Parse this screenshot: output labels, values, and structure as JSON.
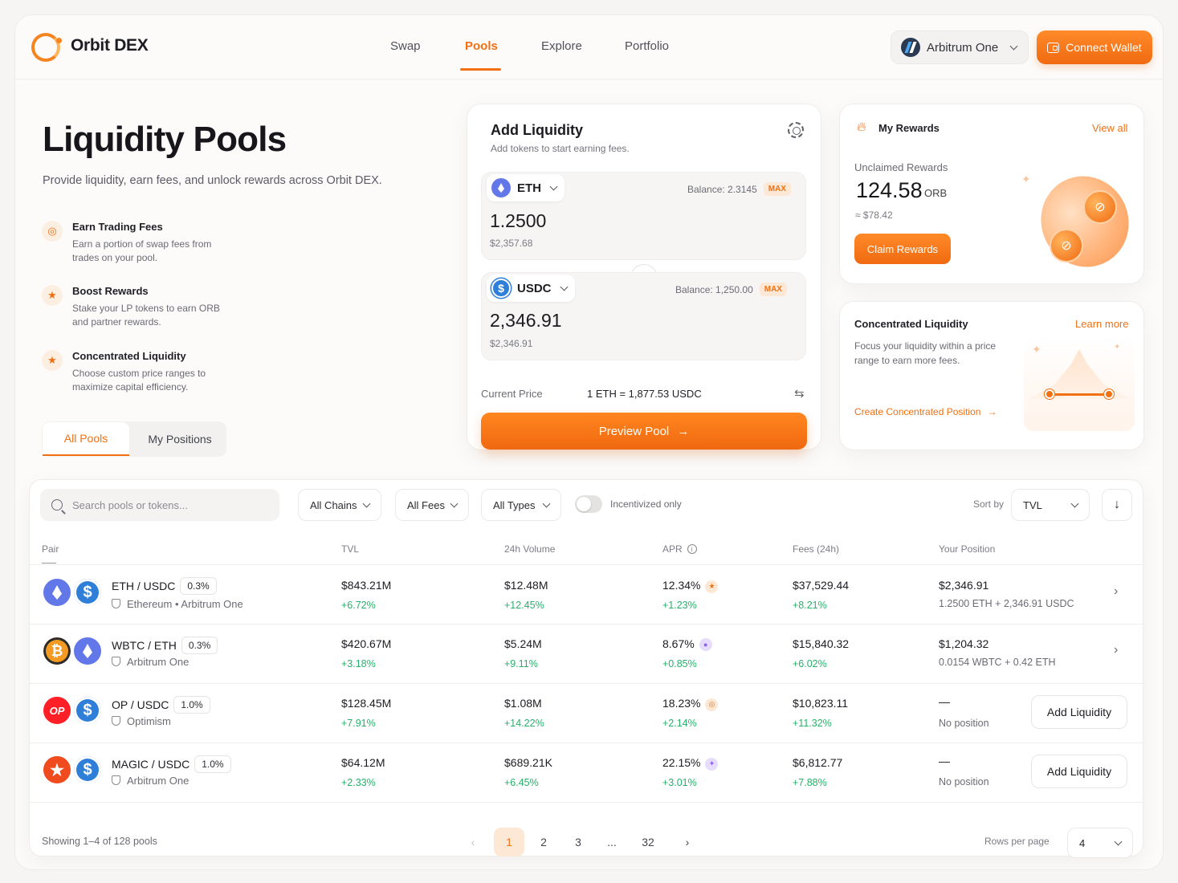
{
  "brand": {
    "name": "Orbit DEX"
  },
  "nav": {
    "items": [
      "Swap",
      "Pools",
      "Explore",
      "Portfolio"
    ],
    "active": "Pools"
  },
  "header": {
    "chain": "Arbitrum One",
    "connect_label": "Connect Wallet"
  },
  "hero": {
    "title": "Liquidity Pools",
    "subtitle": "Provide liquidity, earn fees, and unlock rewards across Orbit DEX.",
    "features": [
      {
        "title": "Earn Trading Fees",
        "desc": "Earn a portion of swap fees from trades on your pool."
      },
      {
        "title": "Boost Rewards",
        "desc": "Stake your LP tokens to earn ORB and partner rewards."
      },
      {
        "title": "Concentrated Liquidity",
        "desc": "Choose custom price ranges to maximize capital efficiency."
      }
    ]
  },
  "tabs": {
    "all": "All Pools",
    "mine": "My Positions"
  },
  "add_liquidity": {
    "title": "Add Liquidity",
    "subtitle": "Add tokens to start earning fees.",
    "token_a": {
      "symbol": "ETH",
      "balance": "Balance: 2.3145",
      "max": "MAX",
      "amount": "1.2500",
      "usd": "$2,357.68"
    },
    "token_b": {
      "symbol": "USDC",
      "balance": "Balance: 1,250.00",
      "max": "MAX",
      "amount": "2,346.91",
      "usd": "$2,346.91"
    },
    "price_label": "Current Price",
    "price_value": "1 ETH = 1,877.53 USDC",
    "preview_label": "Preview Pool"
  },
  "rewards": {
    "title": "My Rewards",
    "view_all": "View all",
    "label": "Unclaimed Rewards",
    "amount": "124.58",
    "unit": "ORB",
    "usd": "≈ $78.42",
    "claim_label": "Claim Rewards"
  },
  "concentrated": {
    "title": "Concentrated Liquidity",
    "learn_more": "Learn more",
    "desc": "Focus your liquidity within a price range to earn more fees.",
    "link": "Create Concentrated Position"
  },
  "filters": {
    "search_placeholder": "Search pools or tokens...",
    "chains": "All Chains",
    "fees": "All Fees",
    "types": "All Types",
    "incentivized": "Incentivized only",
    "sort_label": "Sort by",
    "sort_value": "TVL"
  },
  "table": {
    "columns": [
      "Pair",
      "TVL",
      "24h Volume",
      "APR",
      "Fees (24h)",
      "Your Position"
    ],
    "rows": [
      {
        "pair": "ETH / USDC",
        "fee": "0.3%",
        "chain": "Ethereum • Arbitrum One",
        "tvl": "$843.21M",
        "tvl_d": "+6.72%",
        "vol": "$12.48M",
        "vol_d": "+12.45%",
        "apr": "12.34%",
        "apr_d": "+1.23%",
        "fees": "$37,529.44",
        "fees_d": "+8.21%",
        "pos": "$2,346.91",
        "pos_sub": "1.2500 ETH + 2,346.91 USDC",
        "action": ""
      },
      {
        "pair": "WBTC / ETH",
        "fee": "0.3%",
        "chain": "Arbitrum One",
        "tvl": "$420.67M",
        "tvl_d": "+3.18%",
        "vol": "$5.24M",
        "vol_d": "+9.11%",
        "apr": "8.67%",
        "apr_d": "+0.85%",
        "fees": "$15,840.32",
        "fees_d": "+6.02%",
        "pos": "$1,204.32",
        "pos_sub": "0.0154 WBTC + 0.42 ETH",
        "action": ""
      },
      {
        "pair": "OP / USDC",
        "fee": "1.0%",
        "chain": "Optimism",
        "tvl": "$128.45M",
        "tvl_d": "+7.91%",
        "vol": "$1.08M",
        "vol_d": "+14.22%",
        "apr": "18.23%",
        "apr_d": "+2.14%",
        "fees": "$10,823.11",
        "fees_d": "+11.32%",
        "pos": "—",
        "pos_sub": "No position",
        "action": "Add Liquidity"
      },
      {
        "pair": "MAGIC / USDC",
        "fee": "1.0%",
        "chain": "Arbitrum One",
        "tvl": "$64.12M",
        "tvl_d": "+2.33%",
        "vol": "$689.21K",
        "vol_d": "+6.45%",
        "apr": "22.15%",
        "apr_d": "+3.01%",
        "fees": "$6,812.77",
        "fees_d": "+7.88%",
        "pos": "—",
        "pos_sub": "No position",
        "action": "Add Liquidity"
      }
    ]
  },
  "pagination": {
    "showing": "Showing 1–4 of 128 pools",
    "pages": [
      "1",
      "2",
      "3",
      "...",
      "32"
    ],
    "rows_label": "Rows per page",
    "rows_value": "4"
  },
  "colors": {
    "accent": "#f07012",
    "positive": "#28b06a"
  }
}
